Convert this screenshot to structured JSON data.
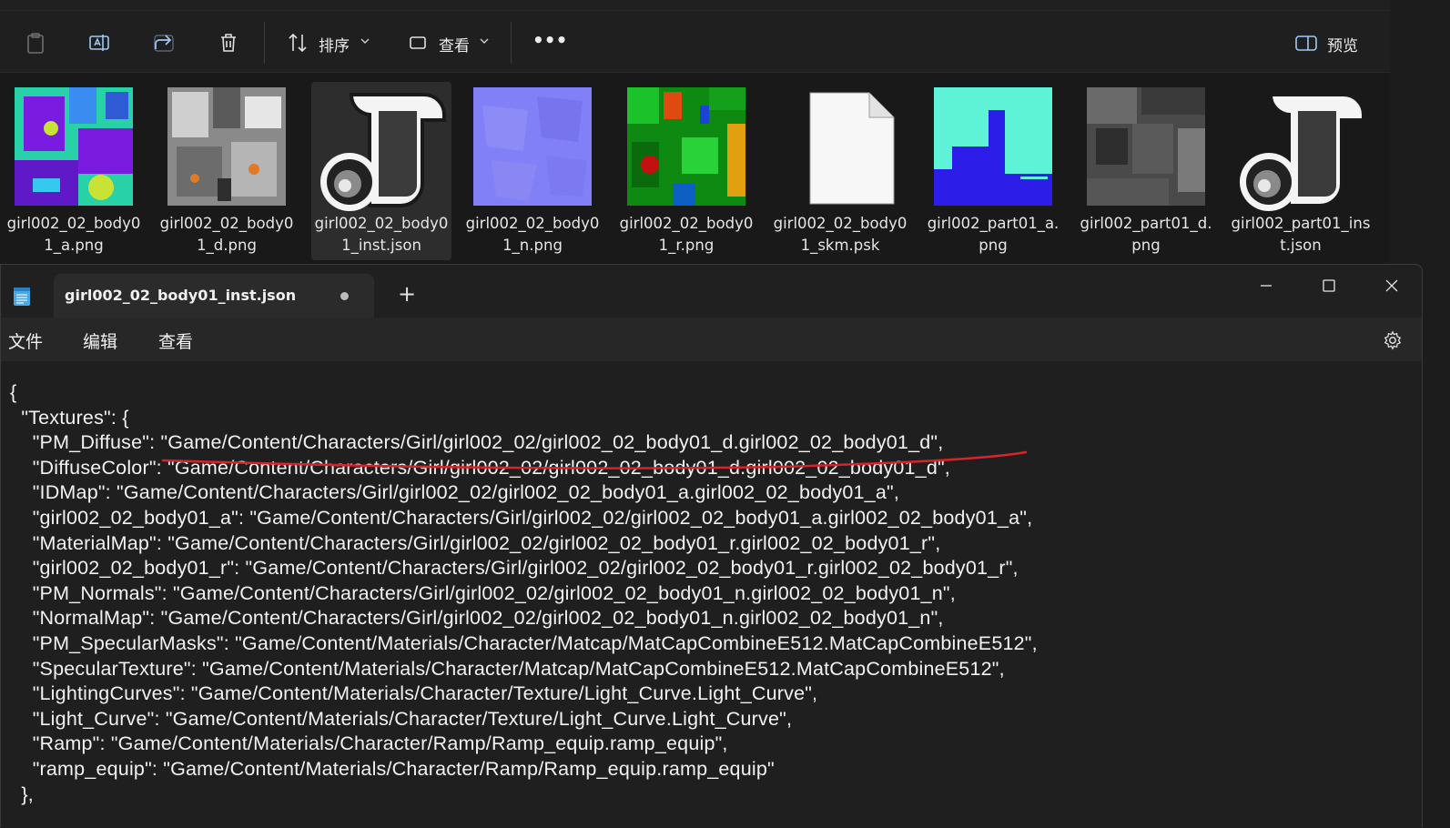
{
  "explorer": {
    "toolbar": {
      "sort_label": "排序",
      "view_label": "查看",
      "more_label": "•••",
      "preview_label": "预览"
    },
    "files": [
      {
        "name": "girl002_02_body01_a.png",
        "kind": "idmap"
      },
      {
        "name": "girl002_02_body01_d.png",
        "kind": "diffuse"
      },
      {
        "name": "girl002_02_body01_inst.json",
        "kind": "json-icon",
        "selected": true
      },
      {
        "name": "girl002_02_body01_n.png",
        "kind": "normal"
      },
      {
        "name": "girl002_02_body01_r.png",
        "kind": "rough"
      },
      {
        "name": "girl002_02_body01_skm.psk",
        "kind": "blank"
      },
      {
        "name": "girl002_part01_a.png",
        "kind": "part-a"
      },
      {
        "name": "girl002_part01_d.png",
        "kind": "part-d"
      },
      {
        "name": "girl002_part01_inst.json",
        "kind": "json-icon"
      }
    ],
    "annotation_color": "#d8232a"
  },
  "notepad": {
    "tab_title": "girl002_02_body01_inst.json",
    "new_tab_symbol": "+",
    "menu": [
      "文件",
      "编辑",
      "查看"
    ],
    "lines": [
      "{",
      "  \"Textures\": {",
      "    \"PM_Diffuse\": \"Game/Content/Characters/Girl/girl002_02/girl002_02_body01_d.girl002_02_body01_d\",",
      "    \"DiffuseColor\": \"Game/Content/Characters/Girl/girl002_02/girl002_02_body01_d.girl002_02_body01_d\",",
      "    \"IDMap\": \"Game/Content/Characters/Girl/girl002_02/girl002_02_body01_a.girl002_02_body01_a\",",
      "    \"girl002_02_body01_a\": \"Game/Content/Characters/Girl/girl002_02/girl002_02_body01_a.girl002_02_body01_a\",",
      "    \"MaterialMap\": \"Game/Content/Characters/Girl/girl002_02/girl002_02_body01_r.girl002_02_body01_r\",",
      "    \"girl002_02_body01_r\": \"Game/Content/Characters/Girl/girl002_02/girl002_02_body01_r.girl002_02_body01_r\",",
      "    \"PM_Normals\": \"Game/Content/Characters/Girl/girl002_02/girl002_02_body01_n.girl002_02_body01_n\",",
      "    \"NormalMap\": \"Game/Content/Characters/Girl/girl002_02/girl002_02_body01_n.girl002_02_body01_n\",",
      "    \"PM_SpecularMasks\": \"Game/Content/Materials/Character/Matcap/MatCapCombineE512.MatCapCombineE512\",",
      "    \"SpecularTexture\": \"Game/Content/Materials/Character/Matcap/MatCapCombineE512.MatCapCombineE512\",",
      "    \"LightingCurves\": \"Game/Content/Materials/Character/Texture/Light_Curve.Light_Curve\",",
      "    \"Light_Curve\": \"Game/Content/Materials/Character/Texture/Light_Curve.Light_Curve\",",
      "    \"Ramp\": \"Game/Content/Materials/Character/Ramp/Ramp_equip.ramp_equip\",",
      "    \"ramp_equip\": \"Game/Content/Materials/Character/Ramp/Ramp_equip.ramp_equip\"",
      "  },"
    ]
  }
}
